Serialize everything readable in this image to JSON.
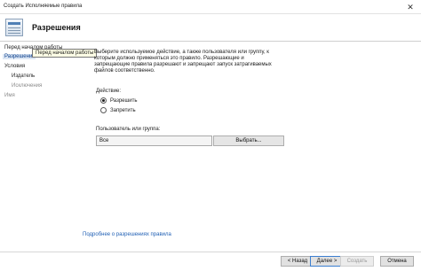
{
  "window": {
    "title": "Создать Исполняемые правила",
    "close_glyph": "✕"
  },
  "header": {
    "title": "Разрешения"
  },
  "sidebar": {
    "items": [
      {
        "label": "Перед началом работы"
      },
      {
        "label": "Разрешения"
      },
      {
        "label": "Условия"
      },
      {
        "label": "Издатель"
      },
      {
        "label": "Исключения"
      },
      {
        "label": "Имя"
      }
    ],
    "tooltip": "Перед началом работы"
  },
  "main": {
    "description": "Выберите используемое действие, а также пользователя или группу, к которым должно применяться это правило. Разрешающие и запрещающие правила разрешают и запрещают запуск затрагиваемых файлов соответственно.",
    "action_label": "Действие:",
    "radios": [
      {
        "label": "Разрешить",
        "selected": true
      },
      {
        "label": "Запретить",
        "selected": false
      }
    ],
    "user_group_label": "Пользователь или группа:",
    "user_group_value": "Все",
    "select_button": "Выбрать...",
    "more_link": "Подробнее о разрешениях правила"
  },
  "footer": {
    "back": "< Назад",
    "next": "Далее >",
    "create": "Создать",
    "cancel": "Отмена"
  }
}
